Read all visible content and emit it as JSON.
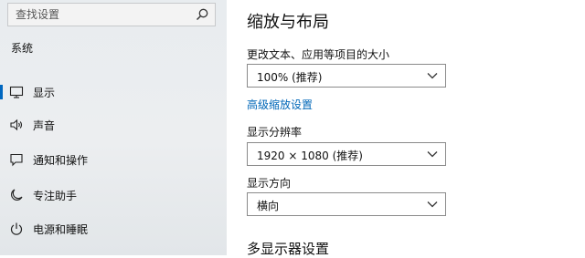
{
  "search": {
    "placeholder": "查找设置"
  },
  "sidebar": {
    "section": "系统",
    "items": [
      {
        "label": "显示",
        "icon": "monitor-icon",
        "selected": true
      },
      {
        "label": "声音",
        "icon": "speaker-icon",
        "selected": false
      },
      {
        "label": "通知和操作",
        "icon": "notification-icon",
        "selected": false
      },
      {
        "label": "专注助手",
        "icon": "moon-icon",
        "selected": false
      },
      {
        "label": "电源和睡眠",
        "icon": "power-icon",
        "selected": false
      }
    ]
  },
  "main": {
    "title": "缩放与布局",
    "scale_label": "更改文本、应用等项目的大小",
    "scale_value": "100% (推荐)",
    "advanced_link": "高级缩放设置",
    "resolution_label": "显示分辨率",
    "resolution_value": "1920 × 1080 (推荐)",
    "orientation_label": "显示方向",
    "orientation_value": "横向",
    "multi_display_title": "多显示器设置"
  },
  "colors": {
    "accent": "#0067c0",
    "link": "#0067b8"
  }
}
